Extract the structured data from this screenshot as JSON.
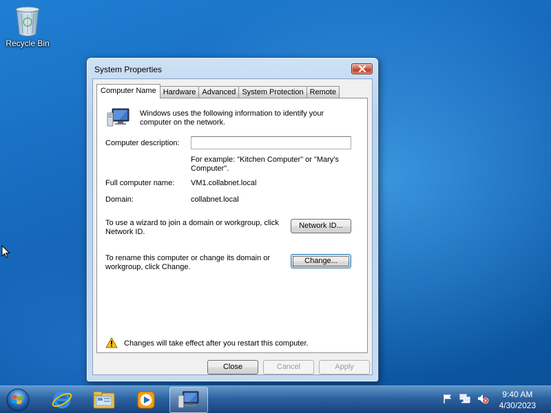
{
  "desktop": {
    "recycle_bin_label": "Recycle Bin"
  },
  "dialog": {
    "title": "System Properties",
    "tabs": [
      {
        "label": "Computer Name",
        "active": true
      },
      {
        "label": "Hardware"
      },
      {
        "label": "Advanced"
      },
      {
        "label": "System Protection"
      },
      {
        "label": "Remote"
      }
    ],
    "intro_text": "Windows uses the following information to identify your computer on the network.",
    "description_label": "Computer description:",
    "description_value": "",
    "example_text": "For example: \"Kitchen Computer\" or \"Mary's Computer\".",
    "full_name_label": "Full computer name:",
    "full_name_value": "VM1.collabnet.local",
    "domain_label": "Domain:",
    "domain_value": "collabnet.local",
    "wizard_text": "To use a wizard to join a domain or workgroup, click Network ID.",
    "network_id_button": "Network ID...",
    "rename_text": "To rename this computer or change its domain or workgroup, click Change.",
    "change_button": "Change...",
    "warning_text": "Changes will take effect after you restart this computer.",
    "close_button": "Close",
    "cancel_button": "Cancel",
    "apply_button": "Apply"
  },
  "taskbar": {
    "items": [
      "start-orb",
      "internet-explorer-icon",
      "windows-explorer-icon",
      "media-player-icon",
      "system-properties-icon"
    ],
    "clock_time": "9:40 AM",
    "clock_date": "4/30/2023"
  },
  "colors": {
    "desktop_blue": "#1565b8",
    "title_bar": "#bcd5ef",
    "close_red": "#c0402b"
  }
}
